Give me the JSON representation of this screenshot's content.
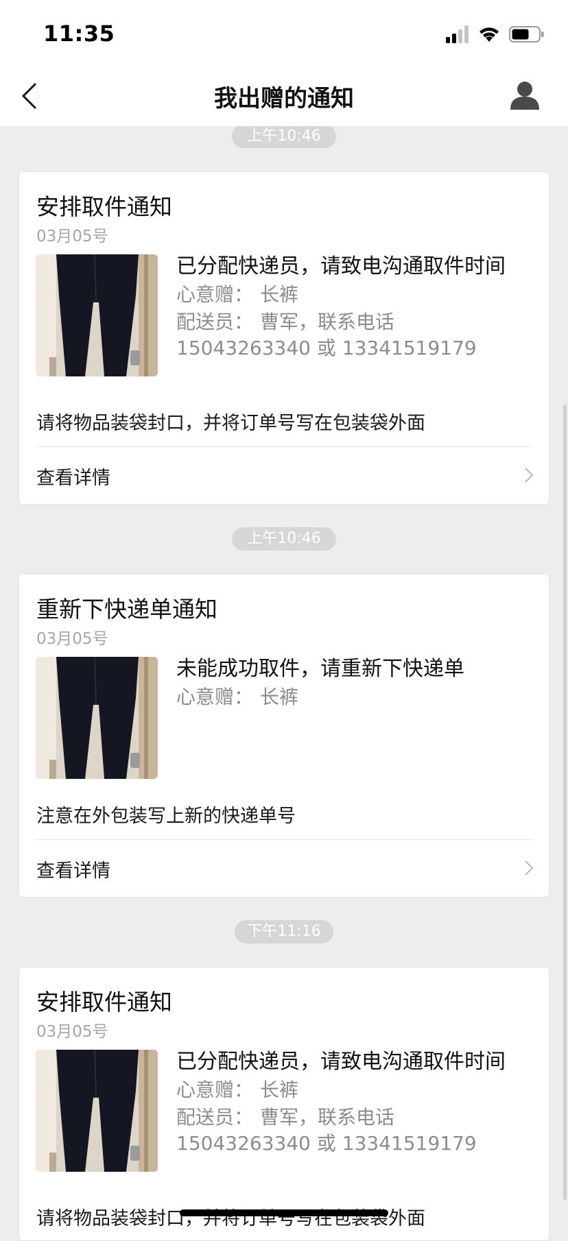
{
  "status_bar": {
    "time": "11:35"
  },
  "nav": {
    "title": "我出赠的通知"
  },
  "colors": {
    "background": "#ededed",
    "card": "#ffffff",
    "pill": "#d6d6d6",
    "muted_text": "#8c8c8c"
  },
  "icons": {
    "back": "chevron-left-icon",
    "avatar": "person-icon",
    "signal": "signal-icon",
    "wifi": "wifi-icon",
    "battery": "battery-icon",
    "detail": "chevron-right-icon"
  },
  "notifications": [
    {
      "time": "上午10:46",
      "title": "安排取件通知",
      "date": "03月05号",
      "headline": "已分配快递员，请致电沟通取件时间",
      "item_label": "心意赠：",
      "item_value": "长裤",
      "courier_label": "配送员：",
      "courier_value": "曹军，联系电话",
      "phones": "15043263340 或 13341519179",
      "note": "请将物品装袋封口，并将订单号写在包装袋外面",
      "detail_label": "查看详情"
    },
    {
      "time": "上午10:46",
      "title": "重新下快递单通知",
      "date": "03月05号",
      "headline": "未能成功取件，请重新下快递单",
      "item_label": "心意赠：",
      "item_value": "长裤",
      "note": "注意在外包装写上新的快递单号",
      "detail_label": "查看详情"
    },
    {
      "time": "下午11:16",
      "title": "安排取件通知",
      "date": "03月05号",
      "headline": "已分配快递员，请致电沟通取件时间",
      "item_label": "心意赠：",
      "item_value": "长裤",
      "courier_label": "配送员：",
      "courier_value": "曹军，联系电话",
      "phones": "15043263340 或 13341519179",
      "note": "请将物品装袋封口，并将订单号写在包装袋外面"
    }
  ]
}
